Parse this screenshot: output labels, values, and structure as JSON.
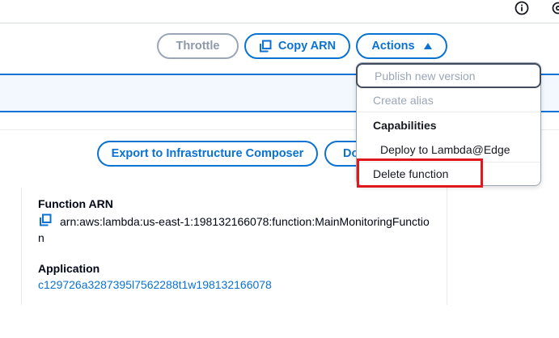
{
  "header": {
    "info_icon": "info-circle-icon",
    "settings_icon": "settings-icon"
  },
  "toolbar": {
    "throttle_label": "Throttle",
    "copy_arn_label": "Copy ARN",
    "actions_label": "Actions",
    "copy_icon": "copy-icon",
    "caret_icon": "caret-up-icon"
  },
  "actions_menu": {
    "publish_label": "Publish new version",
    "create_alias_label": "Create alias",
    "capabilities_heading": "Capabilities",
    "deploy_edge_label": "Deploy to Lambda@Edge",
    "delete_label": "Delete function"
  },
  "diagram_toolbar": {
    "export_label": "Export to Infrastructure Composer",
    "download_label": "Do"
  },
  "details": {
    "function_arn_label": "Function ARN",
    "function_arn_value": "arn:aws:lambda:us-east-1:198132166078:function:MainMonitoringFunction",
    "application_label": "Application",
    "application_value": "c129726a3287395l7562288t1w198132166078"
  },
  "colors": {
    "accent": "#0972d3",
    "disabled": "#9ba7b6",
    "highlight": "#e0181c",
    "banner_bg": "#f2f8fd"
  }
}
